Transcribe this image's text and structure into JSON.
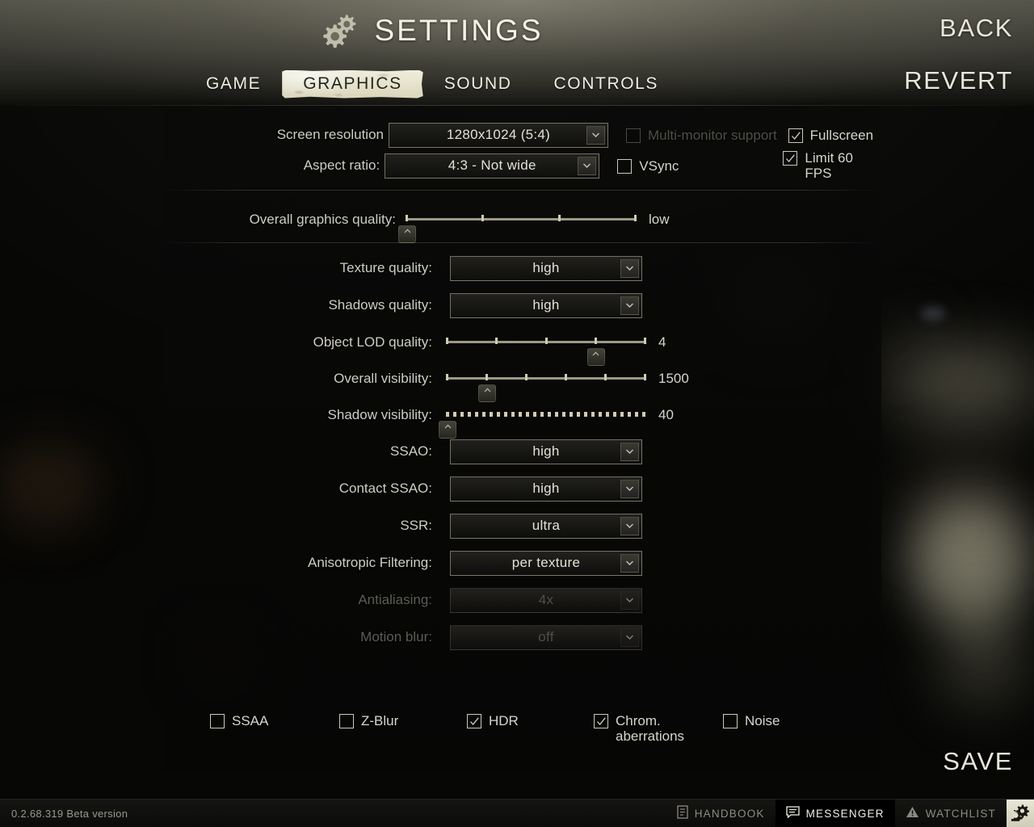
{
  "header": {
    "title": "SETTINGS",
    "gear_icon": "gears-icon",
    "tabs": [
      {
        "label": "GAME",
        "active": false
      },
      {
        "label": "GRAPHICS",
        "active": true
      },
      {
        "label": "SOUND",
        "active": false
      },
      {
        "label": "CONTROLS",
        "active": false
      }
    ]
  },
  "corner_buttons": {
    "back": "BACK",
    "revert": "REVERT",
    "save": "SAVE"
  },
  "display": {
    "resolution_label": "Screen resolution",
    "resolution_value": "1280x1024 (5:4)",
    "aspect_label": "Aspect ratio:",
    "aspect_value": "4:3 - Not wide",
    "multi_monitor": {
      "label": "Multi-monitor support",
      "checked": false,
      "disabled": true
    },
    "fullscreen": {
      "label": "Fullscreen",
      "checked": true,
      "disabled": false
    },
    "vsync": {
      "label": "VSync",
      "checked": false,
      "disabled": false
    },
    "limit_fps": {
      "label": "Limit 60 FPS",
      "checked": true,
      "disabled": false
    }
  },
  "overall_quality": {
    "label": "Overall graphics quality:",
    "value": "low",
    "ticks": 4,
    "position": 0
  },
  "settings_rows": [
    {
      "type": "dropdown",
      "label": "Texture quality:",
      "value": "high",
      "disabled": false
    },
    {
      "type": "dropdown",
      "label": "Shadows quality:",
      "value": "high",
      "disabled": false
    },
    {
      "type": "slider",
      "label": "Object LOD quality:",
      "value": "4",
      "ticks": 5,
      "position": 3
    },
    {
      "type": "slider",
      "label": "Overall visibility:",
      "value": "1500",
      "ticks": 6,
      "position": 1
    },
    {
      "type": "slider",
      "label": "Shadow visibility:",
      "value": "40",
      "ticks": 0,
      "position": 0
    },
    {
      "type": "dropdown",
      "label": "SSAO:",
      "value": "high",
      "disabled": false
    },
    {
      "type": "dropdown",
      "label": "Contact SSAO:",
      "value": "high",
      "disabled": false
    },
    {
      "type": "dropdown",
      "label": "SSR:",
      "value": "ultra",
      "disabled": false
    },
    {
      "type": "dropdown",
      "label": "Anisotropic Filtering:",
      "value": "per texture",
      "disabled": false
    },
    {
      "type": "dropdown",
      "label": "Antialiasing:",
      "value": "4x",
      "disabled": true
    },
    {
      "type": "dropdown",
      "label": "Motion blur:",
      "value": "off",
      "disabled": true
    }
  ],
  "effect_checkboxes": [
    {
      "label": "SSAA",
      "checked": false
    },
    {
      "label": "Z-Blur",
      "checked": false
    },
    {
      "label": "HDR",
      "checked": true
    },
    {
      "label": "Chrom.\naberrations",
      "checked": true
    },
    {
      "label": "Noise",
      "checked": false
    }
  ],
  "taskbar": {
    "version": "0.2.68.319 Beta version",
    "items": [
      {
        "label": "HANDBOOK",
        "icon": "handbook-icon",
        "active": false
      },
      {
        "label": "MESSENGER",
        "icon": "messenger-icon",
        "active": true
      },
      {
        "label": "WATCHLIST",
        "icon": "watchlist-icon",
        "active": false
      }
    ],
    "settings_icon": "gear-icon"
  },
  "colors": {
    "accent": "#e6e3cd",
    "text": "#d8d6cb",
    "dim": "#4f4e48"
  }
}
